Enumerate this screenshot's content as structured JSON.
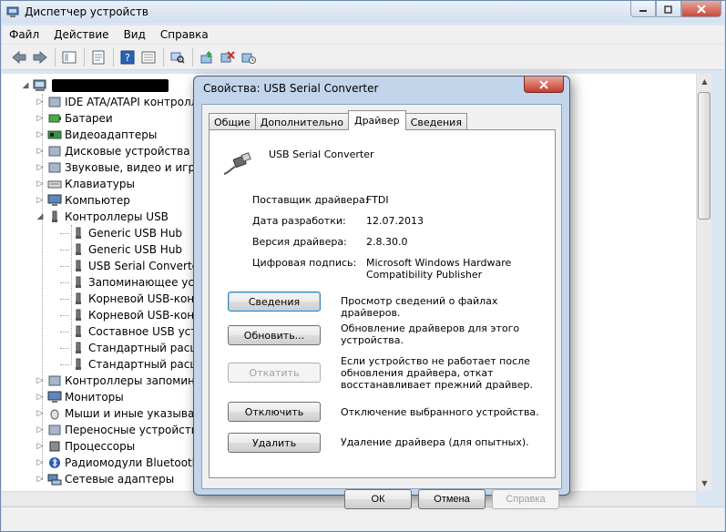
{
  "window": {
    "title": "Диспетчер устройств"
  },
  "menu": {
    "items": [
      "Файл",
      "Действие",
      "Вид",
      "Справка"
    ]
  },
  "toolbar": {
    "icons": [
      "back-arrow-icon",
      "forward-arrow-icon",
      "tree-view-icon",
      "properties-icon",
      "help-icon",
      "device-view-icon",
      "scan-hardware-icon",
      "update-driver-icon",
      "disable-device-icon",
      "uninstall-device-icon"
    ]
  },
  "tree": {
    "items": [
      {
        "label": "IDE ATA/ATAPI контроллеры",
        "icon": "ide-icon"
      },
      {
        "label": "Батареи",
        "icon": "battery-icon"
      },
      {
        "label": "Видеоадаптеры",
        "icon": "display-adapter-icon"
      },
      {
        "label": "Дисковые устройства",
        "icon": "disk-icon"
      },
      {
        "label": "Звуковые, видео и игровые устройства",
        "icon": "sound-icon"
      },
      {
        "label": "Клавиатуры",
        "icon": "keyboard-icon"
      },
      {
        "label": "Компьютер",
        "icon": "computer-icon"
      },
      {
        "label": "Контроллеры USB",
        "icon": "usb-controller-icon"
      },
      {
        "label": "Generic USB Hub",
        "icon": "usb-device-icon"
      },
      {
        "label": "Generic USB Hub",
        "icon": "usb-device-icon"
      },
      {
        "label": "USB Serial Converter",
        "icon": "usb-device-icon"
      },
      {
        "label": "Запоминающее устройство для USB",
        "icon": "usb-device-icon"
      },
      {
        "label": "Корневой USB-концентратор",
        "icon": "usb-device-icon"
      },
      {
        "label": "Корневой USB-концентратор",
        "icon": "usb-device-icon"
      },
      {
        "label": "Составное USB устройство",
        "icon": "usb-device-icon"
      },
      {
        "label": "Стандартный расширенный хост-контроллер",
        "icon": "usb-device-icon"
      },
      {
        "label": "Стандартный расширенный хост-контроллер",
        "icon": "usb-device-icon"
      },
      {
        "label": "Контроллеры запоминающих устройств",
        "icon": "storage-controller-icon"
      },
      {
        "label": "Мониторы",
        "icon": "monitor-icon"
      },
      {
        "label": "Мыши и иные указывающие устройства",
        "icon": "mouse-icon"
      },
      {
        "label": "Переносные устройства",
        "icon": "portable-device-icon"
      },
      {
        "label": "Процессоры",
        "icon": "processor-icon"
      },
      {
        "label": "Радиомодули Bluetooth",
        "icon": "bluetooth-icon"
      },
      {
        "label": "Сетевые адаптеры",
        "icon": "network-adapter-icon"
      }
    ]
  },
  "dialog": {
    "title": "Свойства: USB Serial Converter",
    "tabs": [
      "Общие",
      "Дополнительно",
      "Драйвер",
      "Сведения"
    ],
    "active_tab": "Драйвер",
    "device_name": "USB Serial Converter",
    "props": [
      {
        "label": "Поставщик драйвера:",
        "value": "FTDI"
      },
      {
        "label": "Дата разработки:",
        "value": "12.07.2013"
      },
      {
        "label": "Версия драйвера:",
        "value": "2.8.30.0"
      },
      {
        "label": "Цифровая подпись:",
        "value": "Microsoft Windows Hardware Compatibility Publisher"
      }
    ],
    "buttons": [
      {
        "label": "Сведения",
        "desc": "Просмотр сведений о файлах драйверов."
      },
      {
        "label": "Обновить...",
        "desc": "Обновление драйверов для этого устройства."
      },
      {
        "label": "Откатить",
        "desc": "Если устройство не работает после обновления драйвера, откат восстанавливает прежний драйвер."
      },
      {
        "label": "Отключить",
        "desc": "Отключение выбранного устройства."
      },
      {
        "label": "Удалить",
        "desc": "Удаление драйвера (для опытных)."
      }
    ],
    "footer": {
      "ok": "ОК",
      "cancel": "Отмена",
      "help": "Справка"
    }
  }
}
